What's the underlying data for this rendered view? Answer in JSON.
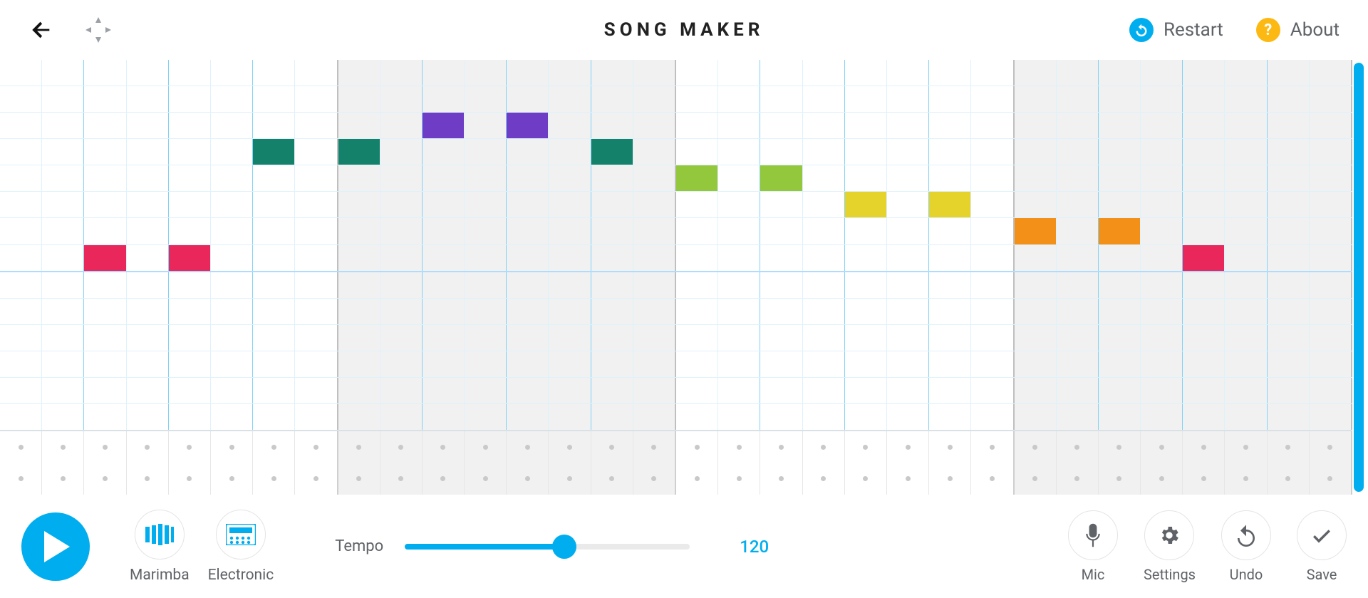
{
  "header": {
    "title": "SONG MAKER",
    "restart_label": "Restart",
    "about_label": "About",
    "about_glyph": "?"
  },
  "grid": {
    "columns": 32,
    "pitch_rows": 14,
    "beat_rows": 2,
    "subdivisions_per_beat": 2,
    "beats_per_bar": 4,
    "shaded_bars": [
      1,
      3
    ],
    "octave_split_after_row": 7,
    "row_colors": [
      "#6f3cc5",
      "#6f3cc5",
      "#14826a",
      "#14826a",
      "#93c83d",
      "#e5d22a",
      "#f39018",
      "#e9275b",
      "#6f3cc5",
      "#6f3cc5",
      "#14826a",
      "#14826a",
      "#93c83d",
      "#e5d22a"
    ],
    "notes": [
      {
        "row": 7,
        "col": 2,
        "color": "#e9275b"
      },
      {
        "row": 7,
        "col": 4,
        "color": "#e9275b"
      },
      {
        "row": 3,
        "col": 6,
        "color": "#14826a"
      },
      {
        "row": 3,
        "col": 8,
        "color": "#14826a"
      },
      {
        "row": 2,
        "col": 10,
        "color": "#6f3cc5"
      },
      {
        "row": 2,
        "col": 12,
        "color": "#6f3cc5"
      },
      {
        "row": 3,
        "col": 14,
        "color": "#14826a"
      },
      {
        "row": 4,
        "col": 16,
        "color": "#93c83d"
      },
      {
        "row": 4,
        "col": 18,
        "color": "#93c83d"
      },
      {
        "row": 5,
        "col": 20,
        "color": "#e5d22a"
      },
      {
        "row": 5,
        "col": 22,
        "color": "#e5d22a"
      },
      {
        "row": 6,
        "col": 24,
        "color": "#f39018"
      },
      {
        "row": 6,
        "col": 26,
        "color": "#f39018"
      },
      {
        "row": 7,
        "col": 28,
        "color": "#e9275b"
      }
    ],
    "beats": []
  },
  "footer": {
    "instrument_melody": "Marimba",
    "instrument_rhythm": "Electronic",
    "tempo_label": "Tempo",
    "tempo_value": "120",
    "tempo_min": 40,
    "tempo_max": 240,
    "tempo_fraction": 0.56,
    "mic_label": "Mic",
    "settings_label": "Settings",
    "undo_label": "Undo",
    "save_label": "Save"
  }
}
